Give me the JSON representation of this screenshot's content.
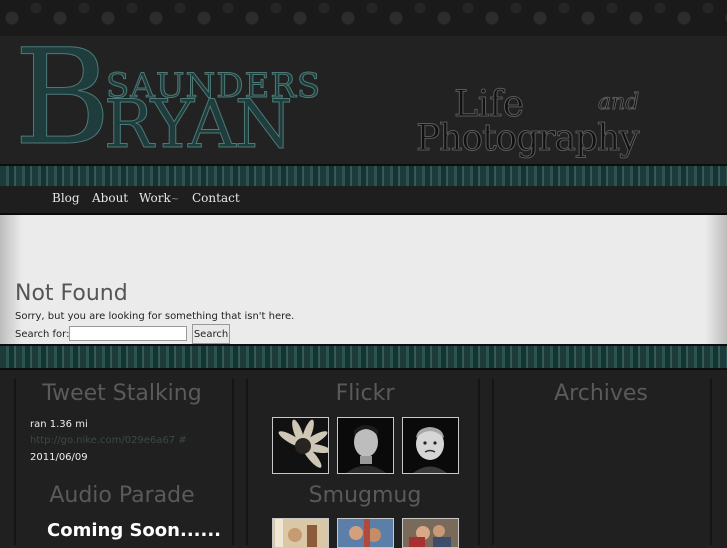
{
  "header": {
    "logo_initial": "B",
    "logo_saunders": "SAUNDERS",
    "logo_ryan": "RYAN",
    "tagline_life": "Life",
    "tagline_and": "and",
    "tagline_photography": "Photography"
  },
  "nav": {
    "items": [
      {
        "label": "Blog"
      },
      {
        "label": "About"
      },
      {
        "label": "Work"
      },
      {
        "label": "Contact"
      }
    ],
    "work_arrow": "~"
  },
  "content": {
    "title": "Not Found",
    "message": "Sorry, but you are looking for something that isn't here.",
    "search_label": "Search for:",
    "search_value": "",
    "search_button": "Search"
  },
  "sidebar": {
    "tweet_title": "Tweet Stalking",
    "tweet_text": "ran 1.36 mi",
    "tweet_link": "http://go.nike.com/029e6a67 #",
    "tweet_date": "2011/06/09",
    "audio_title": "Audio Parade",
    "audio_text": "Coming Soon......",
    "flickr_title": "Flickr",
    "smugmug_title": "Smugmug",
    "archives_title": "Archives"
  },
  "colors": {
    "accent": "#1f3d3c",
    "accent_stroke": "#4d7a77",
    "content_bg": "#ebebeb",
    "page_bg": "#202020"
  }
}
